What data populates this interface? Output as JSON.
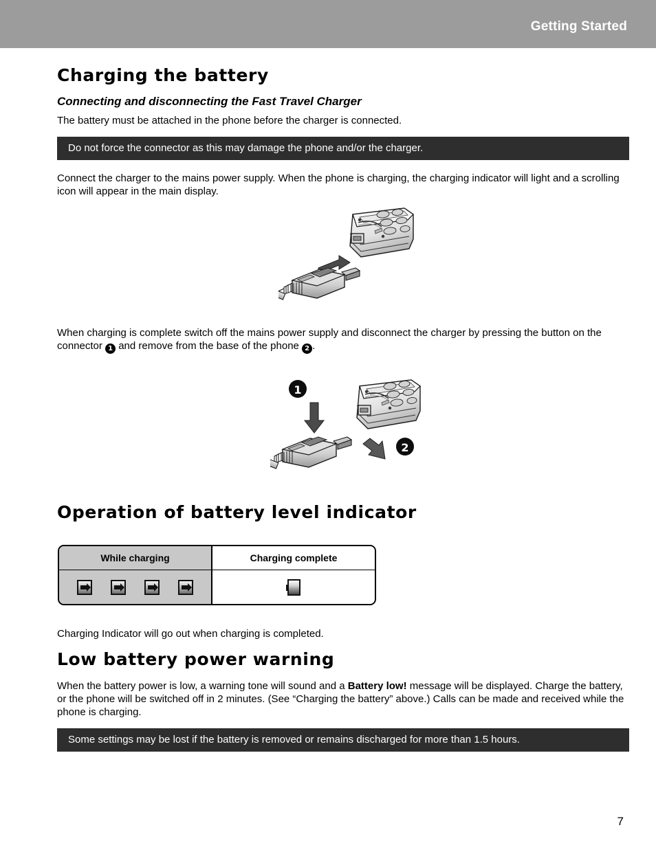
{
  "header": {
    "title": "Getting Started"
  },
  "sections": {
    "charging": {
      "title": "Charging the battery",
      "subtitle": "Connecting and disconnecting the Fast Travel Charger",
      "intro": "The battery must be attached in the phone before the charger is connected.",
      "note1": "Do not force the connector as this may damage the phone and/or the charger.",
      "para1": "Connect the charger to the mains power supply. When the phone is charging, the charging indicator will light and a scrolling icon will appear in the main display.",
      "para2_part1": "When charging is complete switch off the mains power supply and disconnect the charger by pressing the button on the connector",
      "marker1": "1",
      "para2_part2": "and remove from the base of the phone",
      "marker2": "2",
      "para2_part3": "."
    },
    "indicator": {
      "title": "Operation of battery level indicator",
      "table": {
        "headers": [
          "While charging",
          "Charging complete"
        ],
        "while_charging_icons": [
          "charging-arrow-1",
          "charging-arrow-2",
          "charging-arrow-3",
          "charging-arrow-4"
        ],
        "complete_icon": "battery-full"
      },
      "after_table": "Charging Indicator will go out when charging is completed."
    },
    "lowbattery": {
      "title": "Low battery power warning",
      "para_part1": "When the battery power is low, a warning tone will sound and a ",
      "para_bold": "Battery low!",
      "para_part2": " message will be displayed. Charge the battery, or the phone will be switched off in 2 minutes. (See “Charging the battery” above.) Calls can be made and received while the phone is charging.",
      "note2": "Some settings may be lost if the battery is removed or remains discharged for more than 1.5 hours."
    }
  },
  "illustrations": {
    "figure1": {
      "name": "charger-connecting-to-phone",
      "caption_markers": []
    },
    "figure2": {
      "name": "charger-disconnecting-from-phone",
      "marker1": "1",
      "marker2": "2"
    }
  },
  "footer": {
    "page_number": "7"
  },
  "colors": {
    "header_band": "#9c9c9c",
    "note_box": "#2e2e2e",
    "table_left_column": "#c8c8c8"
  }
}
